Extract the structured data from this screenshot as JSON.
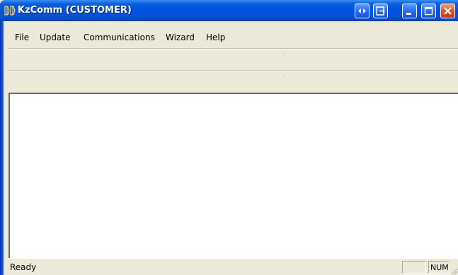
{
  "window": {
    "title": "KzComm (CUSTOMER)"
  },
  "title_buttons": [
    {
      "name": "custom-left-right-button",
      "icon": "left-right-arrows-icon"
    },
    {
      "name": "custom-exit-button",
      "icon": "exit-box-icon"
    },
    {
      "name": "minimize-button",
      "icon": "minimize-icon"
    },
    {
      "name": "maximize-button",
      "icon": "maximize-icon"
    },
    {
      "name": "close-button",
      "icon": "close-icon"
    }
  ],
  "menu": {
    "items": [
      "File",
      "Update",
      "Communications",
      "Wizard",
      "Help"
    ]
  },
  "status": {
    "text": "Ready",
    "indicator": "NUM"
  },
  "colors": {
    "titlebar": "#0054e3",
    "close_button": "#e05a2d",
    "face": "#ece9d8"
  }
}
